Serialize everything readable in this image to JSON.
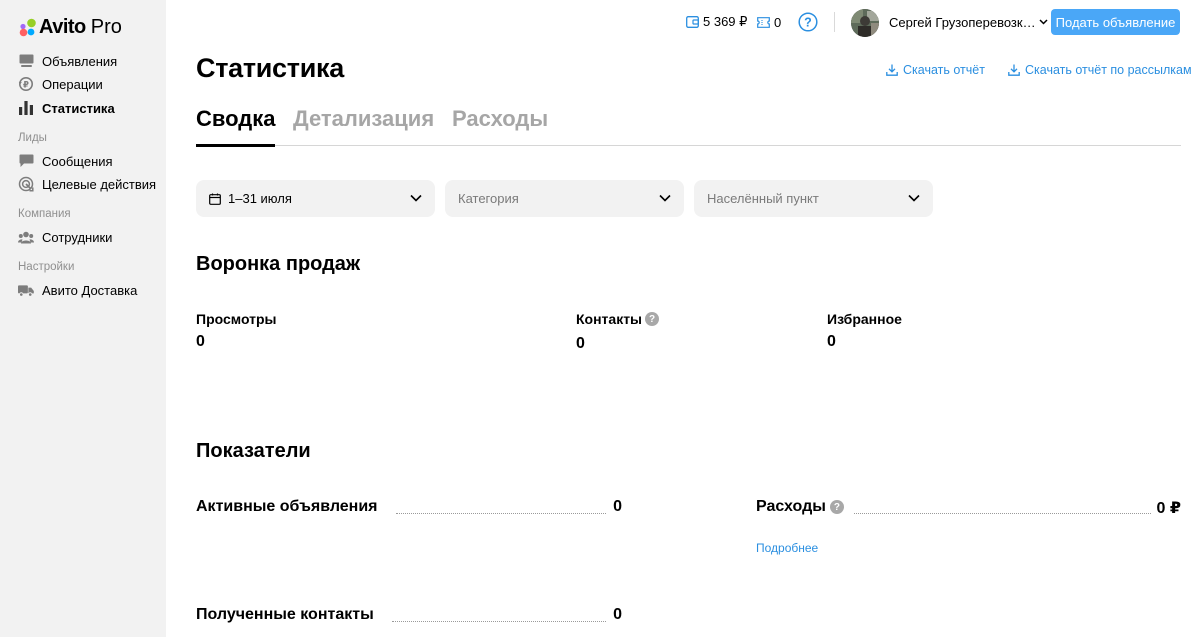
{
  "logo": {
    "brand": "Avito",
    "suffix": "Pro",
    "dot_colors": [
      "#97cf26",
      "#a169f7",
      "#0af",
      "#ff6163"
    ]
  },
  "sidebar": {
    "main": [
      {
        "label": "Объявления",
        "icon": "ads-icon"
      },
      {
        "label": "Операции",
        "icon": "operations-icon"
      },
      {
        "label": "Статистика",
        "icon": "stats-icon",
        "active": true
      }
    ],
    "groups": [
      {
        "title": "Лиды",
        "items": [
          {
            "label": "Сообщения",
            "icon": "chat-icon"
          },
          {
            "label": "Целевые действия",
            "icon": "target-icon"
          }
        ]
      },
      {
        "title": "Компания",
        "items": [
          {
            "label": "Сотрудники",
            "icon": "people-icon"
          }
        ]
      },
      {
        "title": "Настройки",
        "items": [
          {
            "label": "Авито Доставка",
            "icon": "truck-icon"
          }
        ]
      }
    ]
  },
  "topbar": {
    "wallet": "5 369 ₽",
    "bonus": "0",
    "help": "?",
    "username": "Сергей Грузоперевозк…",
    "post_button": "Подать объявление"
  },
  "header": {
    "title": "Статистика",
    "download_report": "Скачать отчёт",
    "download_mailing": "Скачать отчёт по рассылкам"
  },
  "tabs": [
    {
      "label": "Сводка",
      "active": true
    },
    {
      "label": "Детализация",
      "active": false
    },
    {
      "label": "Расходы",
      "active": false
    }
  ],
  "filters": {
    "period": "1–31 июля",
    "category_placeholder": "Категория",
    "city_placeholder": "Населённый пункт"
  },
  "funnel": {
    "title": "Воронка продаж",
    "metrics": [
      {
        "label": "Просмотры",
        "value": "0"
      },
      {
        "label": "Контакты",
        "value": "0"
      },
      {
        "label": "Избранное",
        "value": "0"
      }
    ]
  },
  "indicators": {
    "title": "Показатели",
    "active_ads": {
      "label": "Активные объявления",
      "value": "0"
    },
    "expenses": {
      "label": "Расходы",
      "value": "0 ₽",
      "more": "Подробнее"
    },
    "contacts": {
      "label": "Полученные контакты",
      "value": "0"
    }
  },
  "colors": {
    "accent": "#4aa7f7",
    "link": "#2b8fe0",
    "sidebar_bg": "#f2f2f2"
  }
}
